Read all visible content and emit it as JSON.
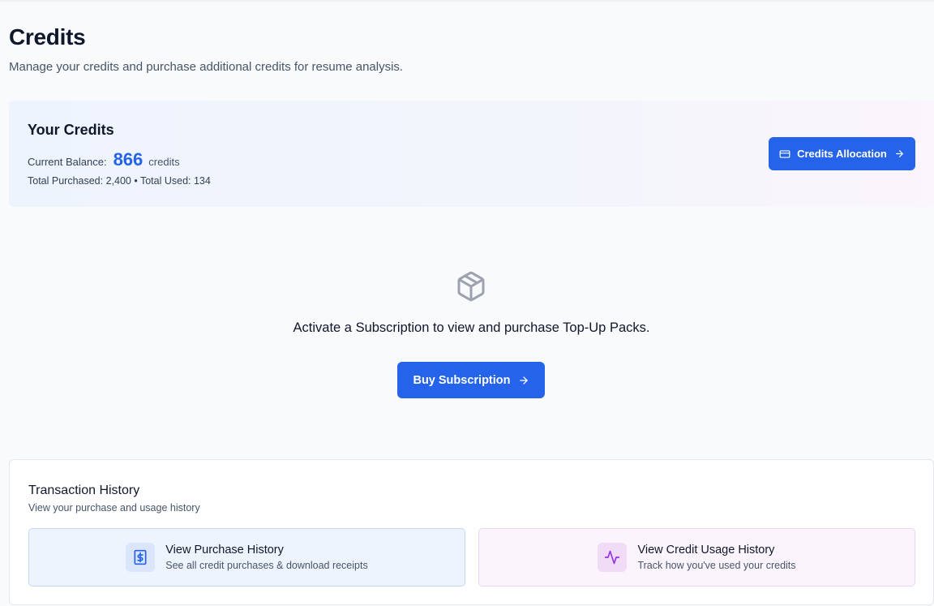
{
  "header": {
    "title": "Credits",
    "subtitle": "Manage your credits and purchase additional credits for resume analysis."
  },
  "credits": {
    "heading": "Your Credits",
    "balance_label": "Current Balance:",
    "balance_value": "866",
    "balance_unit": "credits",
    "totals": "Total Purchased: 2,400 • Total Used: 134",
    "allocation_button": "Credits Allocation",
    "allocation_icon": "credit-card-icon"
  },
  "empty_state": {
    "icon": "package-icon",
    "message": "Activate a Subscription to view and purchase Top-Up Packs.",
    "button": "Buy Subscription"
  },
  "history": {
    "title": "Transaction History",
    "subtitle": "View your purchase and usage history",
    "purchase": {
      "icon": "receipt-dollar-icon",
      "title": "View Purchase History",
      "desc": "See all credit purchases & download receipts"
    },
    "usage": {
      "icon": "activity-icon",
      "title": "View Credit Usage History",
      "desc": "Track how you've used your credits"
    }
  },
  "colors": {
    "accent": "#2563eb",
    "purchase_tile": "#eef4fe",
    "usage_tile": "#fbf4fd",
    "usage_icon": "#9333ea"
  }
}
